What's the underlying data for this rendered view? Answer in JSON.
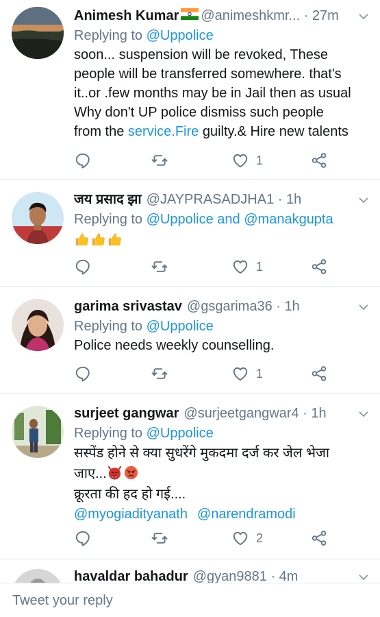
{
  "tweets": [
    {
      "name": "Animesh Kumar",
      "has_flag": true,
      "handle_time": "@animeshkmr... · 27m",
      "reply_prefix": "Replying to ",
      "reply_to": "@Uppolice",
      "lines": [
        "soon... suspension will be revoked, These",
        "people will be transferred somewhere. that's",
        "it..or .few months may be in Jail then as usual",
        "Why don't   UP police dismiss such people"
      ],
      "last_line_pre": "from the ",
      "last_line_link": "service.Fire",
      "last_line_post": " guilty.& Hire new talents",
      "likes": "1"
    },
    {
      "name": "जय प्रसाद झा",
      "handle_time": "@JAYPRASADJHA1 · 1h",
      "reply_prefix": "Replying to ",
      "reply_to": "@Uppolice and @manakgupta",
      "emoji": [
        "thumbs-up",
        "thumbs-up",
        "thumbs-up"
      ],
      "likes": "1"
    },
    {
      "name": "garima srivastav",
      "handle_time": "@gsgarima36 · 1h",
      "reply_prefix": "Replying to ",
      "reply_to": "@Uppolice",
      "text": "Police needs weekly counselling.",
      "likes": "1"
    },
    {
      "name": "surjeet gangwar",
      "handle_time": "@surjeetgangwar4 · 1h",
      "reply_prefix": "Replying to ",
      "reply_to": "@Uppolice",
      "line1": "सस्पेंड होने से क्या सुधरेंगे मुकदमा दर्ज कर जेल भेजा",
      "line2": "जाए...",
      "emoji": [
        "angry-devil",
        "angry-face"
      ],
      "line3": "क्रूरता की हद हो गई....",
      "mention1": "@myogiadityanath",
      "mention2": "@narendramodi",
      "likes": "2"
    },
    {
      "name": "havaldar bahadur",
      "handle_time": "@gyan9881 · 4m"
    }
  ],
  "composer": {
    "placeholder": "Tweet your reply"
  },
  "colors": {
    "link": "#1b95e0",
    "secondary": "#657786",
    "divider": "#e1e8ed"
  }
}
